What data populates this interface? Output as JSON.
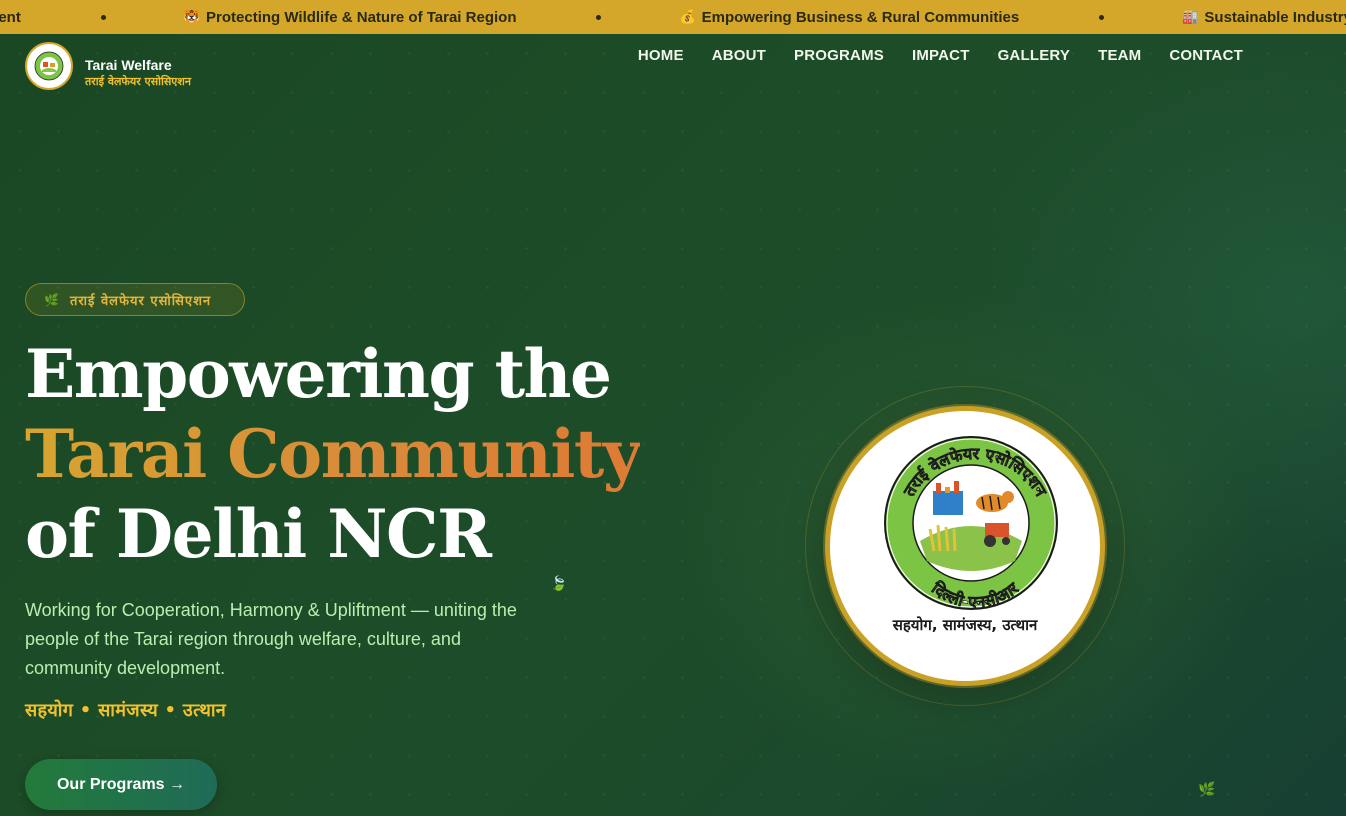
{
  "ticker": {
    "items": [
      {
        "text": "tment",
        "icon": ""
      },
      {
        "text": "Protecting Wildlife & Nature of Tarai Region",
        "icon": "tiger-icon"
      },
      {
        "text": "Empowering Business & Rural Communities",
        "icon": "coin-icon"
      },
      {
        "text": "Sustainable Industry & Development",
        "icon": "factory-icon"
      }
    ]
  },
  "brand": {
    "name_en": "Tarai Welfare",
    "name_hi": "तराई वेलफेयर एसोसिएशन"
  },
  "nav": {
    "items": [
      "HOME",
      "ABOUT",
      "PROGRAMS",
      "IMPACT",
      "GALLERY",
      "TEAM",
      "CONTACT"
    ]
  },
  "hero": {
    "badge": "तराई वेलफेयर एसोसिएशन",
    "title_line1": "Empowering the",
    "title_line2": "Tarai Community",
    "title_line3": "of Delhi NCR",
    "description": "Working for Cooperation, Harmony & Upliftment — uniting the people of the Tarai region through welfare, culture, and community development.",
    "motto": "सहयोग • सामंजस्य • उत्थान",
    "cta_label": "Our Programs →"
  },
  "emblem": {
    "ring_text_top": "तराई वेलफेयर एसोसिएशन",
    "ring_text_bottom": "दिल्ली-एनसीआर",
    "motto": "सहयोग, सामंजस्य, उत्थान"
  },
  "colors": {
    "ticker_bg": "#d4a62a",
    "hero_bg": "#1c4a27",
    "accent_gold": "#f2c12e",
    "accent_orange": "#d98a3a",
    "text_green": "#b8efb0",
    "emblem_green": "#7cc443"
  }
}
